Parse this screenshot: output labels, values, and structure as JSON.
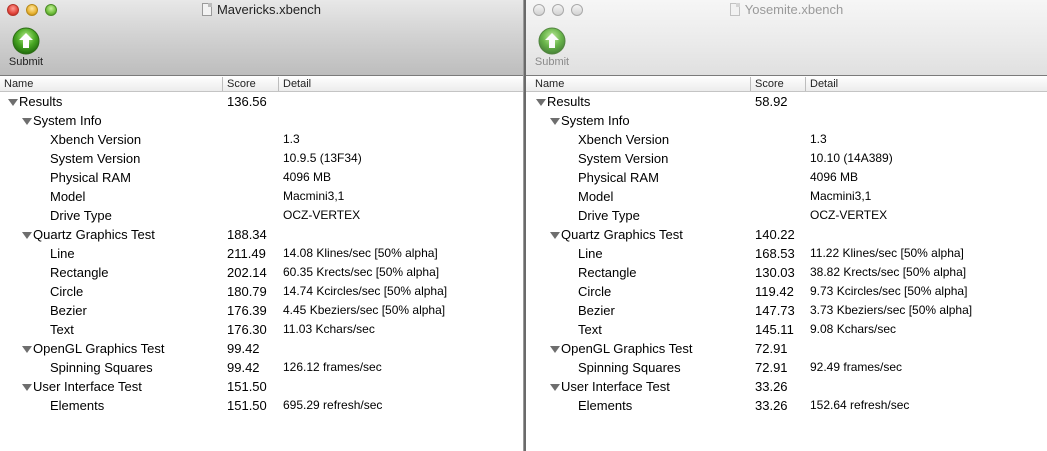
{
  "windows": [
    {
      "title": "Mavericks.xbench",
      "toolbar": {
        "submit_label": "Submit"
      },
      "columns": {
        "name": "Name",
        "score": "Score",
        "detail": "Detail"
      },
      "rows": [
        {
          "label": "Results",
          "score": "136.56",
          "detail": "",
          "level": 0,
          "expanded": true
        },
        {
          "label": "System Info",
          "score": "",
          "detail": "",
          "level": 1,
          "expanded": true
        },
        {
          "label": "Xbench Version",
          "score": "",
          "detail": "1.3",
          "level": 2
        },
        {
          "label": "System Version",
          "score": "",
          "detail": "10.9.5 (13F34)",
          "level": 2
        },
        {
          "label": "Physical RAM",
          "score": "",
          "detail": "4096 MB",
          "level": 2
        },
        {
          "label": "Model",
          "score": "",
          "detail": "Macmini3,1",
          "level": 2
        },
        {
          "label": "Drive Type",
          "score": "",
          "detail": "OCZ-VERTEX",
          "level": 2
        },
        {
          "label": "Quartz Graphics Test",
          "score": "188.34",
          "detail": "",
          "level": 1,
          "expanded": true
        },
        {
          "label": "Line",
          "score": "211.49",
          "detail": "14.08 Klines/sec [50% alpha]",
          "level": 2
        },
        {
          "label": "Rectangle",
          "score": "202.14",
          "detail": "60.35 Krects/sec [50% alpha]",
          "level": 2
        },
        {
          "label": "Circle",
          "score": "180.79",
          "detail": "14.74 Kcircles/sec [50% alpha]",
          "level": 2
        },
        {
          "label": "Bezier",
          "score": "176.39",
          "detail": "4.45 Kbeziers/sec [50% alpha]",
          "level": 2
        },
        {
          "label": "Text",
          "score": "176.30",
          "detail": "11.03 Kchars/sec",
          "level": 2
        },
        {
          "label": "OpenGL Graphics Test",
          "score": "99.42",
          "detail": "",
          "level": 1,
          "expanded": true
        },
        {
          "label": "Spinning Squares",
          "score": "99.42",
          "detail": "126.12 frames/sec",
          "level": 2
        },
        {
          "label": "User Interface Test",
          "score": "151.50",
          "detail": "",
          "level": 1,
          "expanded": true
        },
        {
          "label": "Elements",
          "score": "151.50",
          "detail": "695.29 refresh/sec",
          "level": 2
        }
      ]
    },
    {
      "title": "Yosemite.xbench",
      "toolbar": {
        "submit_label": "Submit"
      },
      "columns": {
        "name": "Name",
        "score": "Score",
        "detail": "Detail"
      },
      "rows": [
        {
          "label": "Results",
          "score": "58.92",
          "detail": "",
          "level": 0,
          "expanded": true
        },
        {
          "label": "System Info",
          "score": "",
          "detail": "",
          "level": 1,
          "expanded": true
        },
        {
          "label": "Xbench Version",
          "score": "",
          "detail": "1.3",
          "level": 2
        },
        {
          "label": "System Version",
          "score": "",
          "detail": "10.10 (14A389)",
          "level": 2
        },
        {
          "label": "Physical RAM",
          "score": "",
          "detail": "4096 MB",
          "level": 2
        },
        {
          "label": "Model",
          "score": "",
          "detail": "Macmini3,1",
          "level": 2
        },
        {
          "label": "Drive Type",
          "score": "",
          "detail": "OCZ-VERTEX",
          "level": 2
        },
        {
          "label": "Quartz Graphics Test",
          "score": "140.22",
          "detail": "",
          "level": 1,
          "expanded": true
        },
        {
          "label": "Line",
          "score": "168.53",
          "detail": "11.22 Klines/sec [50% alpha]",
          "level": 2
        },
        {
          "label": "Rectangle",
          "score": "130.03",
          "detail": "38.82 Krects/sec [50% alpha]",
          "level": 2
        },
        {
          "label": "Circle",
          "score": "119.42",
          "detail": "9.73 Kcircles/sec [50% alpha]",
          "level": 2
        },
        {
          "label": "Bezier",
          "score": "147.73",
          "detail": "3.73 Kbeziers/sec [50% alpha]",
          "level": 2
        },
        {
          "label": "Text",
          "score": "145.11",
          "detail": "9.08 Kchars/sec",
          "level": 2
        },
        {
          "label": "OpenGL Graphics Test",
          "score": "72.91",
          "detail": "",
          "level": 1,
          "expanded": true
        },
        {
          "label": "Spinning Squares",
          "score": "72.91",
          "detail": "92.49 frames/sec",
          "level": 2
        },
        {
          "label": "User Interface Test",
          "score": "33.26",
          "detail": "",
          "level": 1,
          "expanded": true
        },
        {
          "label": "Elements",
          "score": "33.26",
          "detail": "152.64 refresh/sec",
          "level": 2
        }
      ]
    }
  ],
  "icons": {
    "traffic_lights": [
      "close-icon",
      "minimize-icon",
      "zoom-icon"
    ],
    "submit": "upload-arrow-icon",
    "disclosure": "disclosure-triangle-icon"
  },
  "colors": {
    "submit_green": "#3a9a1e",
    "disclosure_gray": "#6e6e6e",
    "title_active": "#222222",
    "title_inactive": "#9a9a9a"
  }
}
